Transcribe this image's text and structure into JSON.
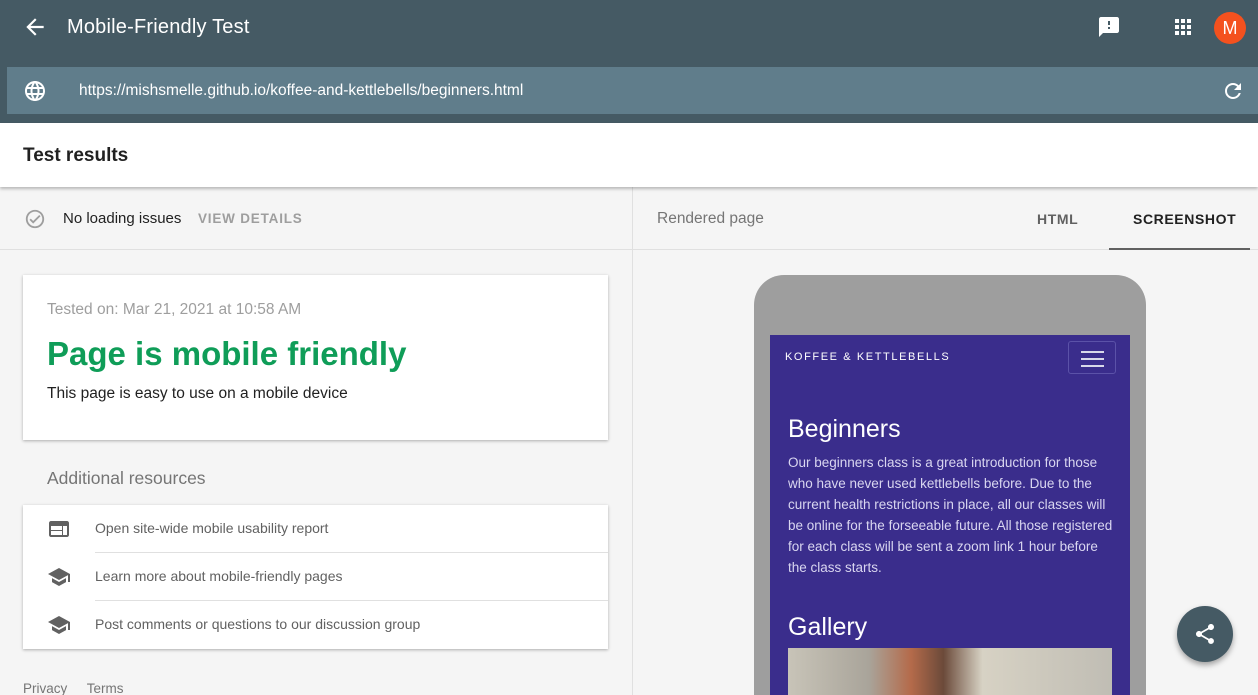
{
  "header": {
    "title": "Mobile-Friendly Test",
    "avatar_initial": "M",
    "url": "https://mishsmelle.github.io/koffee-and-kettlebells/beginners.html"
  },
  "results": {
    "heading": "Test results",
    "status_text": "No loading issues",
    "view_details": "VIEW DETAILS",
    "tested_on": "Tested on: Mar 21, 2021 at 10:58 AM",
    "verdict": "Page is mobile friendly",
    "verdict_color": "#0f9d58",
    "verdict_desc": "This page is easy to use on a mobile device"
  },
  "resources": {
    "heading": "Additional resources",
    "items": [
      {
        "icon": "web-icon",
        "label": "Open site-wide mobile usability report"
      },
      {
        "icon": "school-icon",
        "label": "Learn more about mobile-friendly pages"
      },
      {
        "icon": "school-icon",
        "label": "Post comments or questions to our discussion group"
      }
    ]
  },
  "footer": {
    "privacy": "Privacy",
    "terms": "Terms"
  },
  "rendered": {
    "label": "Rendered page",
    "tabs": [
      {
        "label": "HTML"
      },
      {
        "label": "SCREENSHOT",
        "active": true
      }
    ],
    "site": {
      "brand": "KOFFEE & KETTLEBELLS",
      "heading": "Beginners",
      "paragraph": "Our beginners class is a great introduction for those who have never used kettlebells before. Due to the current health restrictions in place, all our classes will be online for the forseeable future. All those registered for each class will be sent a zoom link 1 hour before the class starts.",
      "gallery_heading": "Gallery",
      "background_color": "#3a2d8c"
    }
  },
  "colors": {
    "appbar": "#455a64",
    "urlbar": "#607d8b",
    "avatar": "#f4511e"
  }
}
